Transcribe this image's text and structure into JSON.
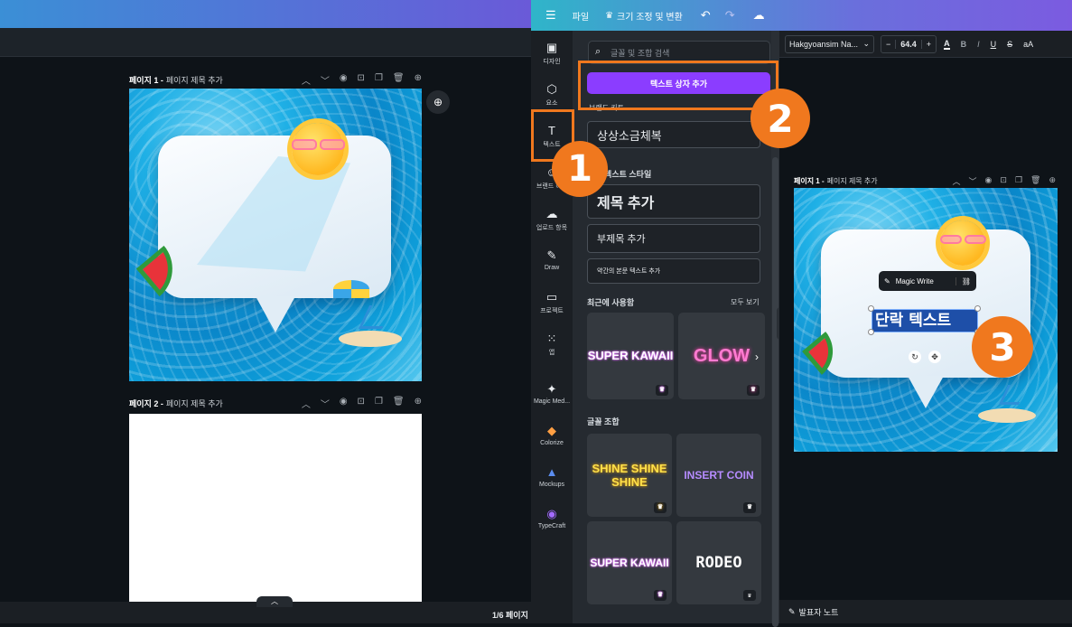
{
  "left": {
    "page1_label": "페이지 1 -",
    "page1_title": "페이지 제목 추가",
    "page2_label": "페이지 2 -",
    "page2_title": "페이지 제목 추가",
    "page_counter": "1/6 페이지"
  },
  "top": {
    "menu_icon": "hamburger-icon",
    "file": "파일",
    "resize": "크기 조정 및 변환",
    "undo_icon": "undo-icon",
    "redo_icon": "redo-icon",
    "cloud_icon": "cloud-save-icon"
  },
  "rail": [
    {
      "label": "디자인",
      "icon": "▣"
    },
    {
      "label": "요소",
      "icon": "⬡"
    },
    {
      "label": "텍스트",
      "icon": "T"
    },
    {
      "label": "브랜드 허브",
      "icon": "☺"
    },
    {
      "label": "업로드 항목",
      "icon": "☁"
    },
    {
      "label": "Draw",
      "icon": "✎"
    },
    {
      "label": "프로젝트",
      "icon": "▭"
    },
    {
      "label": "앱",
      "icon": "⁙"
    },
    {
      "label": "Magic Med...",
      "icon": "✦"
    },
    {
      "label": "Colorize",
      "icon": "◆"
    },
    {
      "label": "Mockups",
      "icon": "▲"
    },
    {
      "label": "TypeCraft",
      "icon": "◉"
    }
  ],
  "text_panel": {
    "search_placeholder": "글꼴 및 조합 검색",
    "add_textbox": "텍스트 상자 추가",
    "brand_kit": "브랜드 키트",
    "brand_font_sample": "상상소금체복",
    "default_styles": "기본 텍스트 스타일",
    "add_heading": "제목 추가",
    "add_subheading": "부제목 추가",
    "add_body": "약간의 본문 텍스트 추가",
    "recent": "최근에 사용함",
    "see_all": "모두 보기",
    "recent_tiles": [
      "SUPER KAWAII",
      "GLOW"
    ],
    "combos": "글꼴 조합",
    "combo_tiles": [
      "SHINE SHINE SHINE",
      "INSERT COIN",
      "SUPER KAWAII",
      "RODEO"
    ]
  },
  "format_toolbar": {
    "font": "Hakgyoansim Na...",
    "minus": "−",
    "size": "64.4",
    "plus": "+",
    "a_icon": "A",
    "bold": "B",
    "italic": "I",
    "underline": "U",
    "strike": "S",
    "case": "aA"
  },
  "right_canvas": {
    "page_label": "페이지 1 -",
    "page_title": "페이지 제목 추가",
    "magic_write": "Magic Write",
    "selected_text": "단락 텍스트",
    "notes": "발표자 노트"
  },
  "badges": [
    "1",
    "2",
    "3"
  ],
  "colors": {
    "accent": "#8b3dff",
    "badge": "#f0781e"
  }
}
